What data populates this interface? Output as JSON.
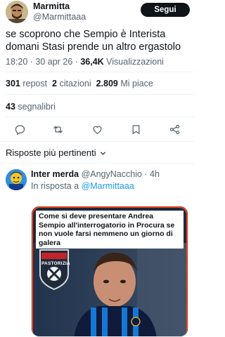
{
  "post": {
    "author": {
      "display_name": "Marmitta",
      "handle": "@Marmittaaa"
    },
    "follow_label": "Segui",
    "text": "se scoprono che Sempio è Interista domani Stasi prende un altro ergastolo",
    "meta": {
      "time_date": "18:20 · 30 apr 26 · ",
      "views_count": "36,4K",
      "views_label": " Visualizzazioni"
    },
    "stats": {
      "reposts_count": "301",
      "reposts_label": " repost",
      "quotes_count": "2",
      "quotes_label": " citazioni",
      "likes_count": "2.809",
      "likes_label": " Mi piace",
      "bookmarks_count": "43",
      "bookmarks_label": " segnalibri"
    }
  },
  "replies_sort": {
    "label": "Risposte più pertinenti"
  },
  "reply": {
    "display_name": "Inter merda",
    "handle": "@AngyNacchio",
    "time": " · 4h",
    "in_reply_prefix": "In risposta a ",
    "in_reply_handle": "@Marmittaaa",
    "media": {
      "caption": "Come si deve presentare Andrea Sempio all'interrogatorio in Procura se non vuole farsi nemmeno un giorno di galera",
      "badge_text": "PASTORIZIA"
    }
  },
  "colors": {
    "text_primary": "#0f1419",
    "text_secondary": "#536471",
    "link": "#1d9bf0",
    "divider": "#eff3f4",
    "media_border": "#e8401c"
  },
  "icons": [
    "reply-icon",
    "repost-icon",
    "like-icon",
    "bookmark-icon",
    "share-icon",
    "chevron-down-icon"
  ]
}
